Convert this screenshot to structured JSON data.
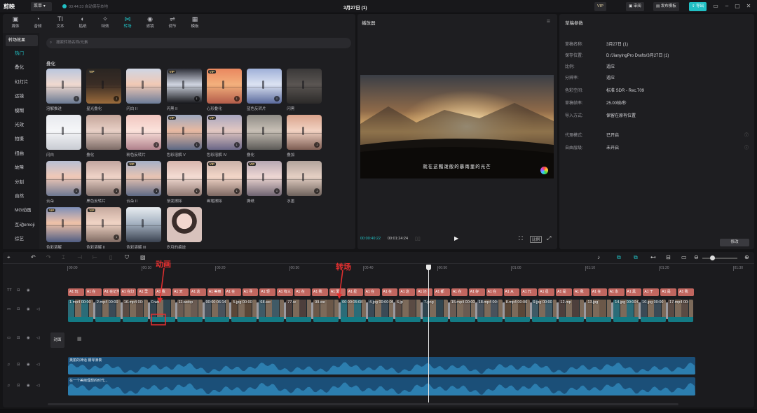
{
  "app": {
    "logo": "剪映",
    "menu_label": "菜单",
    "autosave": "03:44:33 自动保存本地",
    "title": "3月27日 (1)",
    "vip_label": "VIP",
    "review_label": "审阅",
    "publish_template_label": "发布模板",
    "export_label": "导出"
  },
  "toolbar": [
    {
      "label": "媒体",
      "icon": "media-icon"
    },
    {
      "label": "音频",
      "icon": "audio-icon"
    },
    {
      "label": "文本",
      "icon": "text-icon"
    },
    {
      "label": "贴纸",
      "icon": "sticker-icon"
    },
    {
      "label": "特效",
      "icon": "effects-icon"
    },
    {
      "label": "转场",
      "icon": "transition-icon"
    },
    {
      "label": "滤镜",
      "icon": "filter-icon"
    },
    {
      "label": "调节",
      "icon": "adjust-icon"
    },
    {
      "label": "模板",
      "icon": "template-icon"
    }
  ],
  "categories": [
    "转场效果",
    "热门",
    "叠化",
    "幻灯片",
    "运镜",
    "模糊",
    "光效",
    "拍摄",
    "扭曲",
    "故障",
    "分割",
    "自然",
    "MG动画",
    "互动emoji",
    "综艺"
  ],
  "search": {
    "placeholder": "搜索转场名称/元素"
  },
  "section_title": "叠化",
  "transitions": [
    {
      "label": "溶解推进",
      "vip": false,
      "dl": true
    },
    {
      "label": "星光叠化",
      "vip": true,
      "dl": true
    },
    {
      "label": "闪白 II",
      "vip": false,
      "dl": false
    },
    {
      "label": "闪黑 II",
      "vip": true,
      "dl": true
    },
    {
      "label": "心形叠化",
      "vip": true,
      "dl": true
    },
    {
      "label": "蓝色反转片",
      "vip": false,
      "dl": true
    },
    {
      "label": "闪黑",
      "vip": false,
      "dl": false
    },
    {
      "label": "闪白",
      "vip": false,
      "dl": false
    },
    {
      "label": "叠化",
      "vip": false,
      "dl": false
    },
    {
      "label": "粉色反转片",
      "vip": false,
      "dl": true
    },
    {
      "label": "色彩溶解 V",
      "vip": true,
      "dl": true
    },
    {
      "label": "色彩溶解 IV",
      "vip": true,
      "dl": true
    },
    {
      "label": "叠化",
      "vip": false,
      "dl": false
    },
    {
      "label": "叠加",
      "vip": false,
      "dl": true
    },
    {
      "label": "云朵",
      "vip": false,
      "dl": true
    },
    {
      "label": "黑色反转片",
      "vip": false,
      "dl": true
    },
    {
      "label": "云朵 II",
      "vip": true,
      "dl": true
    },
    {
      "label": "渐变擦除",
      "vip": false,
      "dl": true
    },
    {
      "label": "画笔擦除",
      "vip": true,
      "dl": true
    },
    {
      "label": "撕纸",
      "vip": true,
      "dl": true
    },
    {
      "label": "水墨",
      "vip": false,
      "dl": true
    },
    {
      "label": "色彩溶解",
      "vip": true,
      "dl": false
    },
    {
      "label": "色彩溶解 II",
      "vip": true,
      "dl": true
    },
    {
      "label": "色彩溶解 III",
      "vip": false,
      "dl": false
    },
    {
      "label": "岁月的痕迹",
      "vip": false,
      "dl": false
    }
  ],
  "player": {
    "title": "播放器",
    "subtitle": "就在这瓢泼般的暴雨里的光芒",
    "current_time": "00:00:40:22",
    "total_time": "00:01:24:24",
    "ratio_label": "比例"
  },
  "params": {
    "title": "草稿参数",
    "rows": [
      {
        "label": "草稿名称:",
        "value": "3月27日 (1)"
      },
      {
        "label": "保存位置:",
        "value": "D:/JianyingPro Drafts/3月27日 (1)"
      },
      {
        "label": "比例:",
        "value": "适应"
      },
      {
        "label": "分辨率:",
        "value": "适应"
      },
      {
        "label": "色彩空间:",
        "value": "标准 SDR - Rec.709"
      },
      {
        "label": "草稿帧率:",
        "value": "25.00帧/秒"
      },
      {
        "label": "导入方式:",
        "value": "保留在原有位置"
      },
      {
        "label": "代理模式:",
        "value": "已开启"
      },
      {
        "label": "自由层级:",
        "value": "未开启"
      }
    ],
    "modify_label": "修改"
  },
  "timeline": {
    "ruler": [
      "00:00",
      "00:10",
      "00:20",
      "00:30",
      "00:40",
      "00:50",
      "01:00",
      "01:10",
      "01:20",
      "01:30"
    ],
    "cover_label": "封面",
    "annotation_animation": "动画",
    "annotation_transition": "转场",
    "stickers": [
      "A1 玩",
      "A1 在",
      "A1 在记当",
      "A1 在幻",
      "A1 里",
      "A1 我",
      "A1 天",
      "A1 这",
      "A1 美丽",
      "A1 在",
      "A1 寻",
      "A1 轻",
      "A1 有三",
      "A1 在",
      "A1 我",
      "A1 爱",
      "A1 星",
      "A1 在",
      "A1 在",
      "A1 这",
      "A1 还",
      "A1 都",
      "A1 在",
      "A1 好",
      "A1 在",
      "A1 从",
      "A1 冗",
      "A1 星",
      "A1 是",
      "A1 我",
      "A1 在",
      "A1 永",
      "A1 黑",
      "A1 于",
      "A1 是",
      "A1 我"
    ],
    "clips": [
      {
        "label": "1.mp4 00:00"
      },
      {
        "label": "2.mp4 00:00"
      },
      {
        "label": "16.mp4 00:"
      },
      {
        "label": "0.we"
      },
      {
        "label": "11.webp"
      },
      {
        "label": "00:00:06:14"
      },
      {
        "label": "5.jpg 00:00"
      },
      {
        "label": "68.we"
      },
      {
        "label": "77.w"
      },
      {
        "label": "99.we"
      },
      {
        "label": "00:00:05:08"
      },
      {
        "label": "4.jpg 00:00:05:17"
      },
      {
        "label": "6.jp"
      },
      {
        "label": "7.png"
      },
      {
        "label": "15.mp4 00:00"
      },
      {
        "label": "18.mp4 00:"
      },
      {
        "label": "8.mp4 00:00"
      },
      {
        "label": "9.jpg 00:00"
      },
      {
        "label": "12.mp"
      },
      {
        "label": "13.jpg"
      },
      {
        "label": "14.jpg 00:00:05"
      },
      {
        "label": "10.jpg 00:00"
      },
      {
        "label": "17.mp4 00:"
      }
    ],
    "audio1_label": "奥丽的神话 钢琴演奏",
    "audio2_label": "在一个美丽理想的时代..."
  },
  "colors": {
    "accent": "#21c0c4",
    "annotation": "#e53030",
    "sticker": "#c1665f",
    "audio": "#1b4f78"
  }
}
